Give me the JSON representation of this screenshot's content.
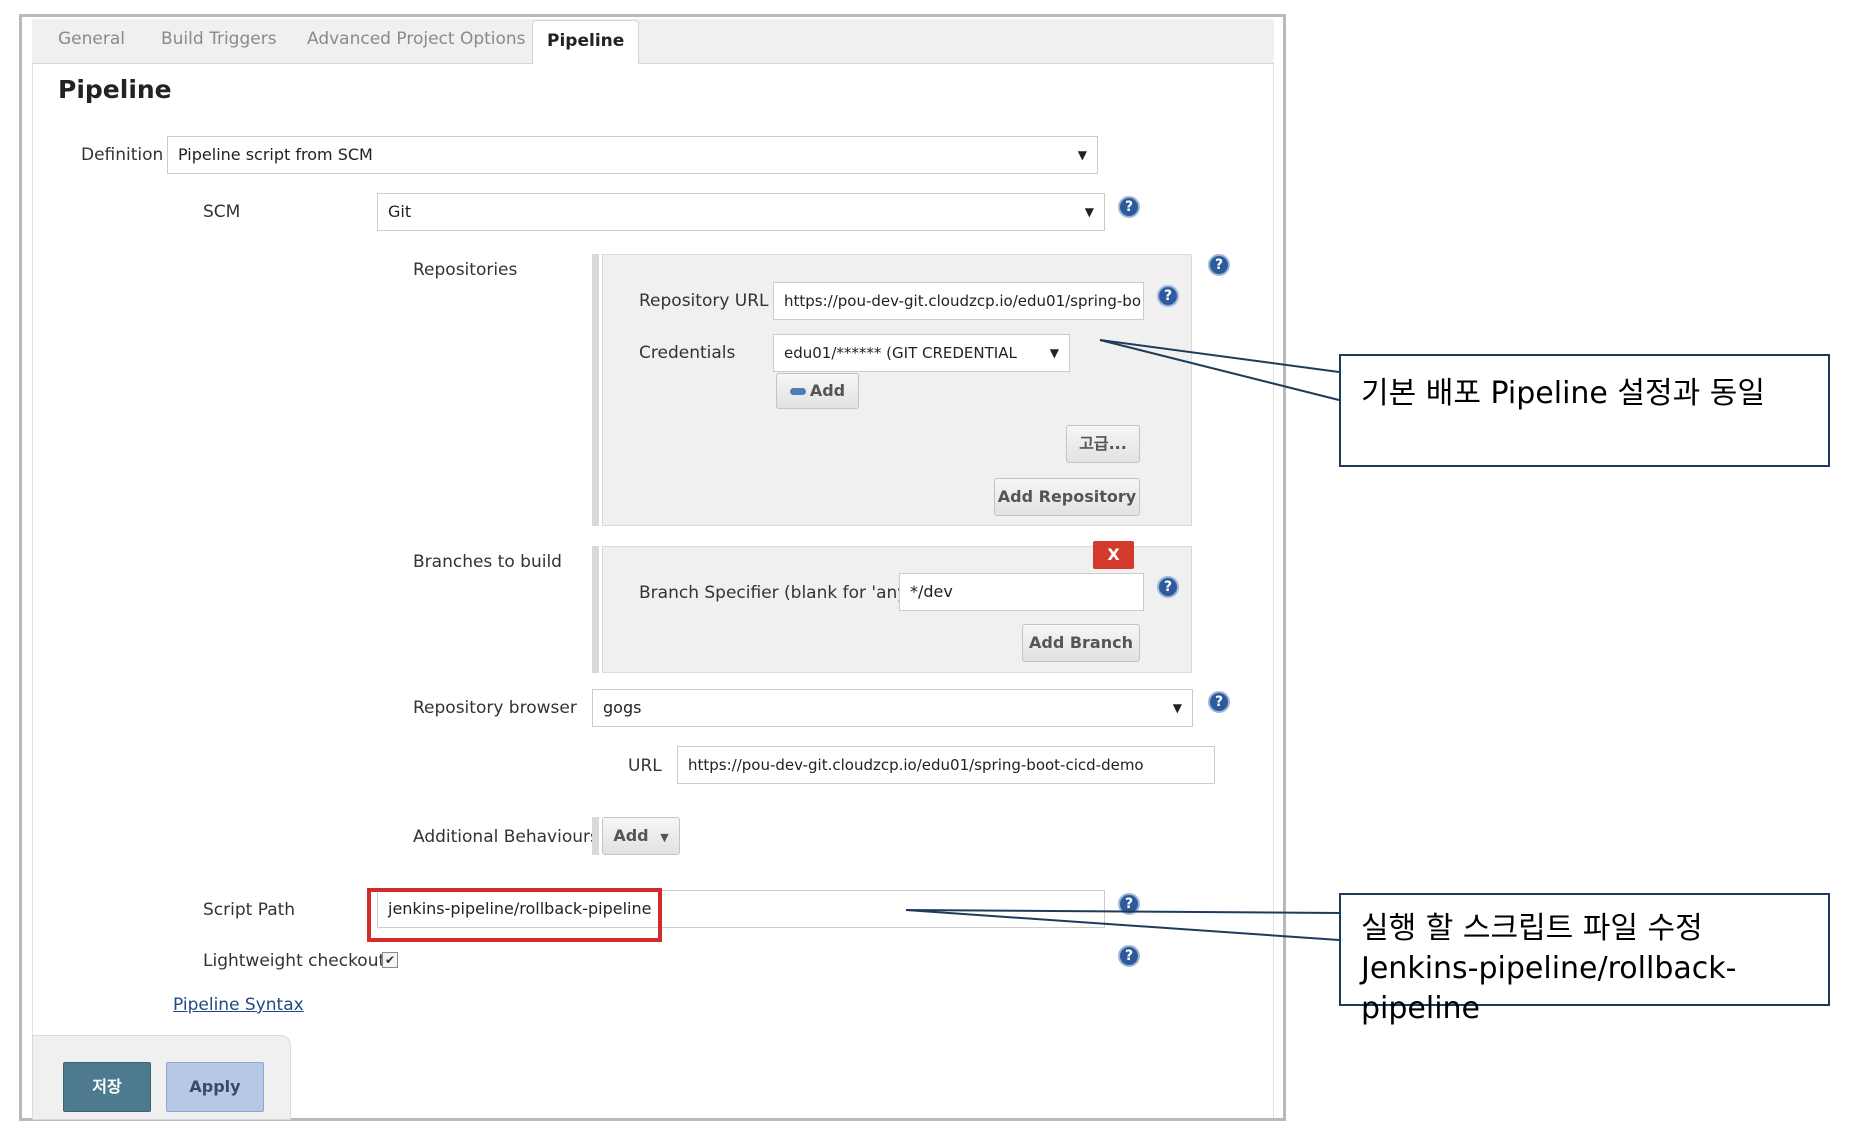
{
  "tabs": [
    {
      "label": "General"
    },
    {
      "label": "Build Triggers"
    },
    {
      "label": "Advanced Project Options"
    },
    {
      "label": "Pipeline",
      "active": true
    }
  ],
  "section": {
    "title": "Pipeline"
  },
  "definition": {
    "label": "Definition",
    "value": "Pipeline script from SCM"
  },
  "scm": {
    "label": "SCM",
    "value": "Git"
  },
  "repositories": {
    "label": "Repositories",
    "url_label": "Repository URL",
    "url_value": "https://pou-dev-git.cloudzcp.io/edu01/spring-bo",
    "credentials_label": "Credentials",
    "credentials_value": "edu01/****** (GIT  CREDENTIAL",
    "add_label": "Add",
    "advanced_label": "고급...",
    "add_repository_label": "Add Repository"
  },
  "branches": {
    "label": "Branches to build",
    "delete_label": "X",
    "specifier_label": "Branch Specifier (blank for 'any')",
    "specifier_value": "*/dev",
    "add_branch_label": "Add Branch"
  },
  "repo_browser": {
    "label": "Repository browser",
    "value": "gogs",
    "url_label": "URL",
    "url_value": "https://pou-dev-git.cloudzcp.io/edu01/spring-boot-cicd-demo"
  },
  "additional_behaviours": {
    "label": "Additional Behaviours",
    "add_label": "Add"
  },
  "script_path": {
    "label": "Script Path",
    "value": "jenkins-pipeline/rollback-pipeline"
  },
  "lightweight": {
    "label": "Lightweight checkout",
    "checked": true,
    "mark": "✔"
  },
  "pipeline_syntax": {
    "label": "Pipeline Syntax"
  },
  "footer": {
    "save_label": "저장",
    "apply_label": "Apply"
  },
  "help_glyph": "?",
  "select_arrow": "▼",
  "callouts": {
    "top": {
      "line1": "기본 배포 Pipeline 설정과 동일"
    },
    "bottom": {
      "line1": "실행 할 스크립트 파일 수정",
      "line2": "Jenkins-pipeline/rollback-pipeline"
    }
  },
  "colors": {
    "highlight_border": "#d32a2a",
    "save_button": "#4d7a8f",
    "apply_button": "#b5c9e6",
    "delete_button": "#d33a2c",
    "help_icon": "#2c5a9a",
    "callout_border": "#1f3b5c"
  }
}
